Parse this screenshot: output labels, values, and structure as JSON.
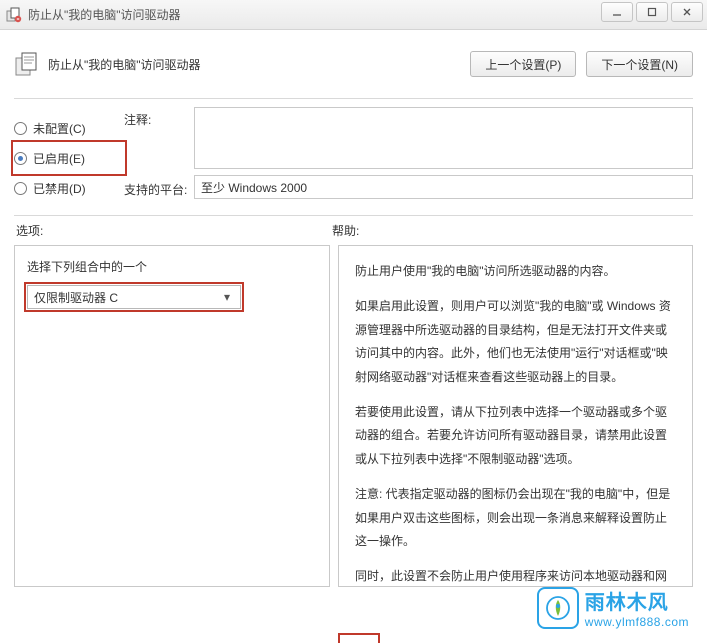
{
  "window": {
    "title": "防止从\"我的电脑\"访问驱动器"
  },
  "header": {
    "page_title": "防止从\"我的电脑\"访问驱动器",
    "prev_label": "上一个设置(P)",
    "next_label": "下一个设置(N)"
  },
  "radios": {
    "not_configured": "未配置(C)",
    "enabled": "已启用(E)",
    "disabled": "已禁用(D)",
    "selected": "enabled"
  },
  "fields": {
    "comment_label": "注释:",
    "comment_value": "",
    "platform_label": "支持的平台:",
    "platform_value": "至少 Windows 2000"
  },
  "lower": {
    "options_heading": "选项:",
    "help_heading": "帮助:",
    "combo_label": "选择下列组合中的一个",
    "combo_value": "仅限制驱动器 C",
    "help_paragraphs": [
      "防止用户使用\"我的电脑\"访问所选驱动器的内容。",
      "如果启用此设置，则用户可以浏览\"我的电脑\"或 Windows 资源管理器中所选驱动器的目录结构，但是无法打开文件夹或访问其中的内容。此外，他们也无法使用\"运行\"对话框或\"映射网络驱动器\"对话框来查看这些驱动器上的目录。",
      "若要使用此设置，请从下拉列表中选择一个驱动器或多个驱动器的组合。若要允许访问所有驱动器目录，请禁用此设置或从下拉列表中选择\"不限制驱动器\"选项。",
      "注意: 代表指定驱动器的图标仍会出现在\"我的电脑\"中，但是如果用户双击这些图标，则会出现一条消息来解释设置防止这一操作。",
      "同时，此设置不会防止用户使用程序来访问本地驱动器和网络驱动器。也不会防止他们使用\"磁盘管理\"管理单元查看并更改驱动器特性。"
    ]
  },
  "watermark": {
    "brand": "雨林木风",
    "url": "www.ylmf888.com"
  }
}
